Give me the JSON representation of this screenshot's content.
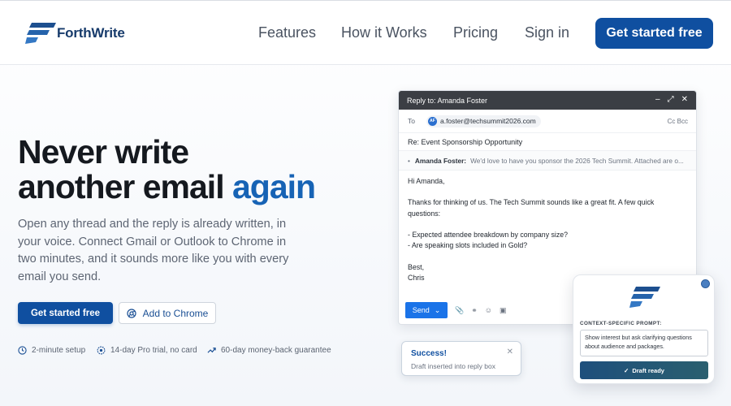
{
  "brand": {
    "name": "ForthWrite",
    "color": "#0f4fa0",
    "accent": "#1763b5"
  },
  "nav": {
    "links": [
      "Features",
      "How it Works",
      "Pricing",
      "Sign in"
    ],
    "cta": "Get started free"
  },
  "hero": {
    "title_line1": "Never write",
    "title_line2_prefix": "another email ",
    "title_accent": "again",
    "subtitle": "Open any thread and the reply is already written, in your voice. Connect Gmail or Outlook to Chrome in two minutes, and it sounds more like you with every email you send.",
    "primary_button": "Get started free",
    "secondary_button": "Add to Chrome",
    "features": [
      {
        "icon": "clock-icon",
        "text": "2-minute setup"
      },
      {
        "icon": "badge-icon",
        "text": "14-day Pro trial, no card"
      },
      {
        "icon": "trend-up-icon",
        "text": "60-day money-back guarantee"
      }
    ]
  },
  "email": {
    "window_title": "Reply to: Amanda Foster",
    "to_label": "To",
    "recipient_initials": "AF",
    "recipient": "a.foster@techsummit2026.com",
    "cc_bcc": "Cc  Bcc",
    "subject": "Re: Event Sponsorship Opportunity",
    "quote_sender": "Amanda Foster:",
    "quote_text": "We'd love to have you sponsor the 2026 Tech Summit. Attached are o...",
    "body": {
      "greeting": "Hi Amanda,",
      "para1": "Thanks for thinking of us. The Tech Summit sounds like a great fit. A few quick questions:",
      "q1": "- Expected attendee breakdown by company size?",
      "q2": "- Are speaking slots included in Gold?",
      "signoff": "Best,",
      "name": "Chris"
    },
    "send_label": "Send"
  },
  "toast": {
    "title": "Success!",
    "message": "Draft inserted into reply box"
  },
  "prompt_card": {
    "label": "CONTEXT-SPECIFIC PROMPT:",
    "prompt_text": "Show interest but ask clarifying questions about audience and packages.",
    "status_button": "Draft ready"
  }
}
